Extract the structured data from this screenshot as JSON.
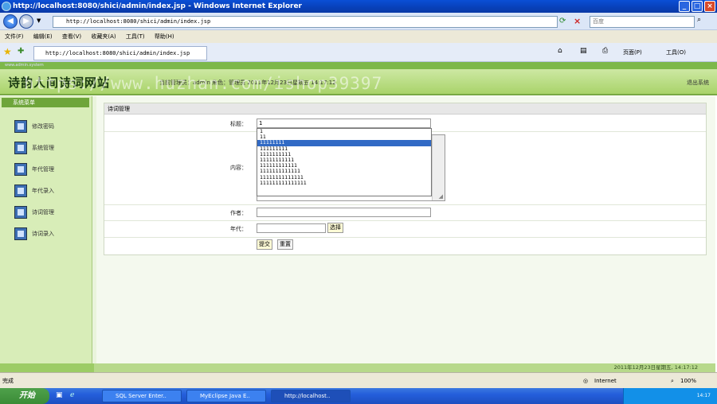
{
  "window": {
    "title": "http://localhost:8080/shici/admin/index.jsp - Windows Internet Explorer"
  },
  "address": {
    "url": "http://localhost:8080/shici/admin/index.jsp",
    "search_placeholder": "百度"
  },
  "menu": [
    "文件(F)",
    "编辑(E)",
    "查看(V)",
    "收藏夹(A)",
    "工具(T)",
    "帮助(H)"
  ],
  "tab": {
    "label": "http://localhost:8080/shici/admin/index.jsp"
  },
  "toolbar": {
    "page": "页面(P)",
    "tools": "工具(O)"
  },
  "site": {
    "topstrip": "www.admin.system",
    "title": "诗韵人间诗词网站",
    "user_info": "当前管理员：admin  角色：管理员    2011年12月23日星期五 14:17:12",
    "logout": "退出系统",
    "watermark": "https://www.huzhan.com/ishop39397"
  },
  "sidebar": {
    "heading": "系统菜单",
    "items": [
      "修改密码",
      "系统管理",
      "年代管理",
      "年代录入",
      "诗词管理",
      "诗词录入"
    ]
  },
  "form": {
    "panel_title": "诗词管理",
    "title_label": "标题：",
    "title_value": "1",
    "content_label": "内容：",
    "author_label": "作者：",
    "dynasty_label": "年代：",
    "select_button": "选择",
    "submit_button": "提交",
    "reset_button": "重置"
  },
  "autocomplete": [
    "1",
    "11",
    "11111111",
    "111111111",
    "1111111111",
    "11111111111",
    "111111111111",
    "1111111111111",
    "11111111111111",
    "111111111111111"
  ],
  "autocomplete_selected_index": 2,
  "footer_date": "2011年12月23日星期五, 14:17:12",
  "statusbar": {
    "status": "完成",
    "zone": "Internet",
    "zoom": "100%"
  },
  "taskbar": {
    "start": "开始",
    "tasks": [
      "SQL Server Enter..",
      "MyEclipse Java E..",
      "http://localhost.."
    ],
    "clock": "14:17"
  }
}
